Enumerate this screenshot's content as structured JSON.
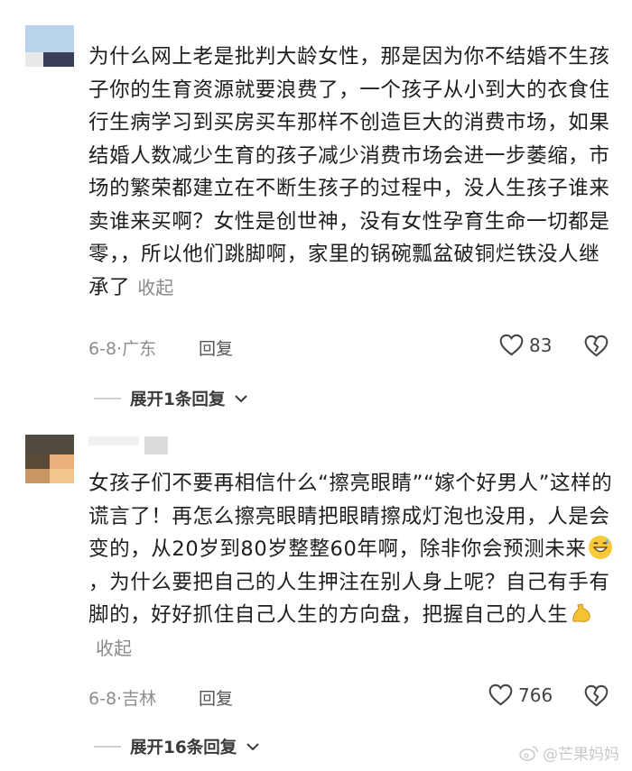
{
  "comments": [
    {
      "text": "为什么网上老是批判大龄女性，那是因为你不结婚不生孩子你的生育资源就要浪费了，一个孩子从小到大的衣食住行生病学习到买房买车那样不创造巨大的消费市场，如果结婚人数减少生育的孩子减少消费市场会进一步萎缩，市场的繁荣都建立在不断生孩子的过程中，没人生孩子谁来卖谁来买啊？女性是创世神，没有女性孕育生命一切都是零，，所以他们跳脚啊，家里的锅碗瓢盆破铜烂铁没人继承了",
      "collapse_label": "收起",
      "date": "6-8",
      "location": "广东",
      "reply_label": "回复",
      "likes": "83",
      "expand_label": "展开1条回复"
    },
    {
      "text_before_emoji": "女孩子们不要再相信什么“擦亮眼睛”“嫁个好男人”这样的谎言了！再怎么擦亮眼睛把眼睛擦成灯泡也没用，人是会变的，从20岁到80岁整整60年啊，除非你会预测未来",
      "text_after_emoji": "，为什么要把自己的人生押注在别人身上呢？自己有手有脚的，好好抓住自己人生的方向盘，把握自己的人生",
      "collapse_label": "收起",
      "date": "6-8",
      "location": "吉林",
      "reply_label": "回复",
      "likes": "766",
      "expand_label": "展开16条回复"
    }
  ],
  "separator": "·",
  "watermark": "@芒果妈妈",
  "icons": {
    "emoji_1": "grinning-sweat-emoji",
    "emoji_2": "flexed-biceps-emoji",
    "like": "heart-outline-icon",
    "dislike": "broken-heart-icon",
    "expand": "chevron-down-icon",
    "watermark": "weibo-logo"
  },
  "colors": {
    "text": "#1e1e1e",
    "meta": "#8d8d8d",
    "collapse": "#8a8a8a",
    "watermark": "#c9c9c9"
  }
}
